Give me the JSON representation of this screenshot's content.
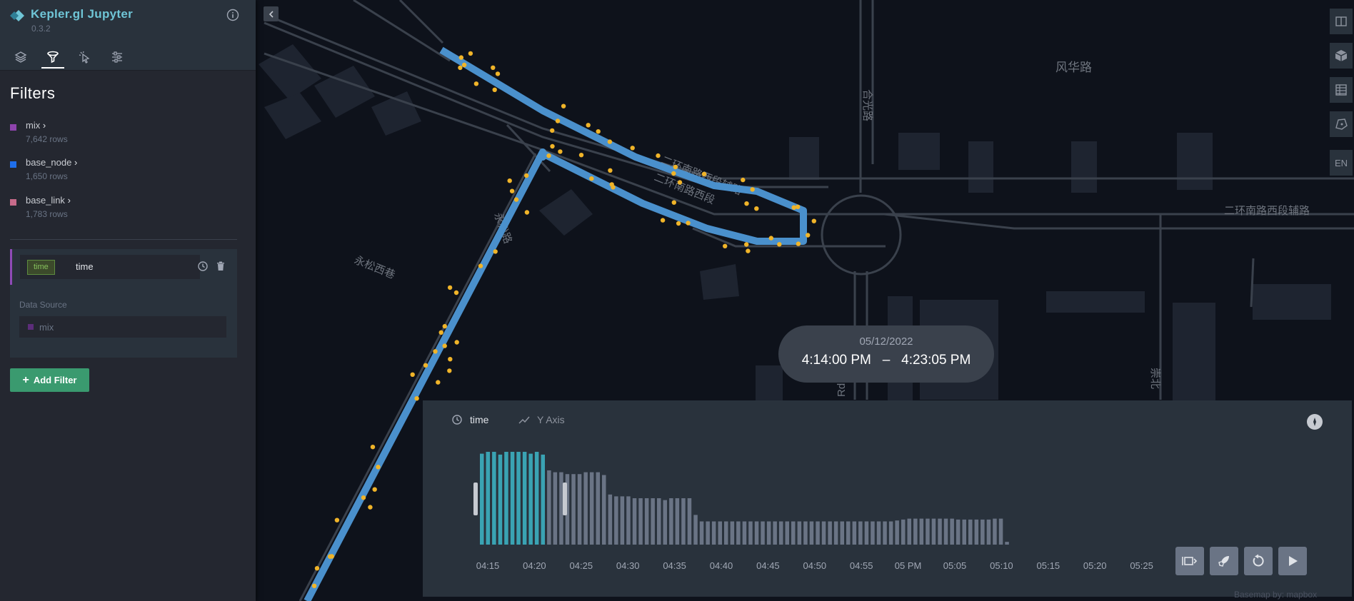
{
  "app": {
    "title": "Kepler.gl Jupyter",
    "version": "0.3.2"
  },
  "side_panel": {
    "tabs": [
      {
        "name": "layers",
        "active": false
      },
      {
        "name": "filters",
        "active": true
      },
      {
        "name": "interactions",
        "active": false
      },
      {
        "name": "map-settings",
        "active": false
      }
    ],
    "title": "Filters",
    "datasets": [
      {
        "name": "mix",
        "rows": "7,642 rows",
        "color": "#8e44ad"
      },
      {
        "name": "base_node",
        "rows": "1,650 rows",
        "color": "#1f6feb"
      },
      {
        "name": "base_link",
        "rows": "1,783 rows",
        "color": "#c76b8a"
      }
    ],
    "filter": {
      "type_tag": "time",
      "field": "time",
      "data_source_label": "Data Source",
      "data_source": "mix"
    },
    "add_filter_label": "Add Filter"
  },
  "map": {
    "labels": [
      "风华路",
      "二环南路西段辅路",
      "二环南路西段辅路",
      "二环南路西段",
      "永松西巷",
      "合光路",
      "永松路",
      "崇北",
      "Rd"
    ],
    "controls": [
      "split-map",
      "3d-view",
      "data-table",
      "draw",
      "EN"
    ]
  },
  "time_label": {
    "date": "05/12/2022",
    "start": "4:14:00 PM",
    "separator": "–",
    "end": "4:23:05 PM"
  },
  "time_widget": {
    "field_label": "time",
    "y_axis_label": "Y Axis",
    "ticks": [
      "04:15",
      "04:20",
      "04:25",
      "04:30",
      "04:35",
      "04:40",
      "04:45",
      "04:50",
      "04:55",
      "05 PM",
      "05:05",
      "05:10",
      "05:15",
      "05:20",
      "05:25"
    ],
    "histogram_heights": [
      0.98,
      1.0,
      1.0,
      0.97,
      1.0,
      1.0,
      1.0,
      1.0,
      0.98,
      1.0,
      0.97,
      0.8,
      0.78,
      0.78,
      0.76,
      0.76,
      0.76,
      0.78,
      0.78,
      0.78,
      0.75,
      0.54,
      0.52,
      0.52,
      0.52,
      0.5,
      0.5,
      0.5,
      0.5,
      0.5,
      0.48,
      0.5,
      0.5,
      0.5,
      0.5,
      0.32,
      0.25,
      0.25,
      0.25,
      0.25,
      0.25,
      0.25,
      0.25,
      0.25,
      0.25,
      0.25,
      0.25,
      0.25,
      0.25,
      0.25,
      0.25,
      0.25,
      0.25,
      0.25,
      0.25,
      0.25,
      0.25,
      0.25,
      0.25,
      0.25,
      0.25,
      0.25,
      0.25,
      0.25,
      0.25,
      0.25,
      0.25,
      0.25,
      0.26,
      0.27,
      0.28,
      0.28,
      0.28,
      0.28,
      0.28,
      0.28,
      0.28,
      0.28,
      0.27,
      0.27,
      0.27,
      0.27,
      0.27,
      0.27,
      0.28,
      0.28,
      0.03
    ],
    "selected_range_bars": [
      0,
      10
    ],
    "colors": {
      "selected": "#3aa3b3",
      "unselected": "#6a7485"
    }
  },
  "attribution": "Basemap by: mapbox"
}
